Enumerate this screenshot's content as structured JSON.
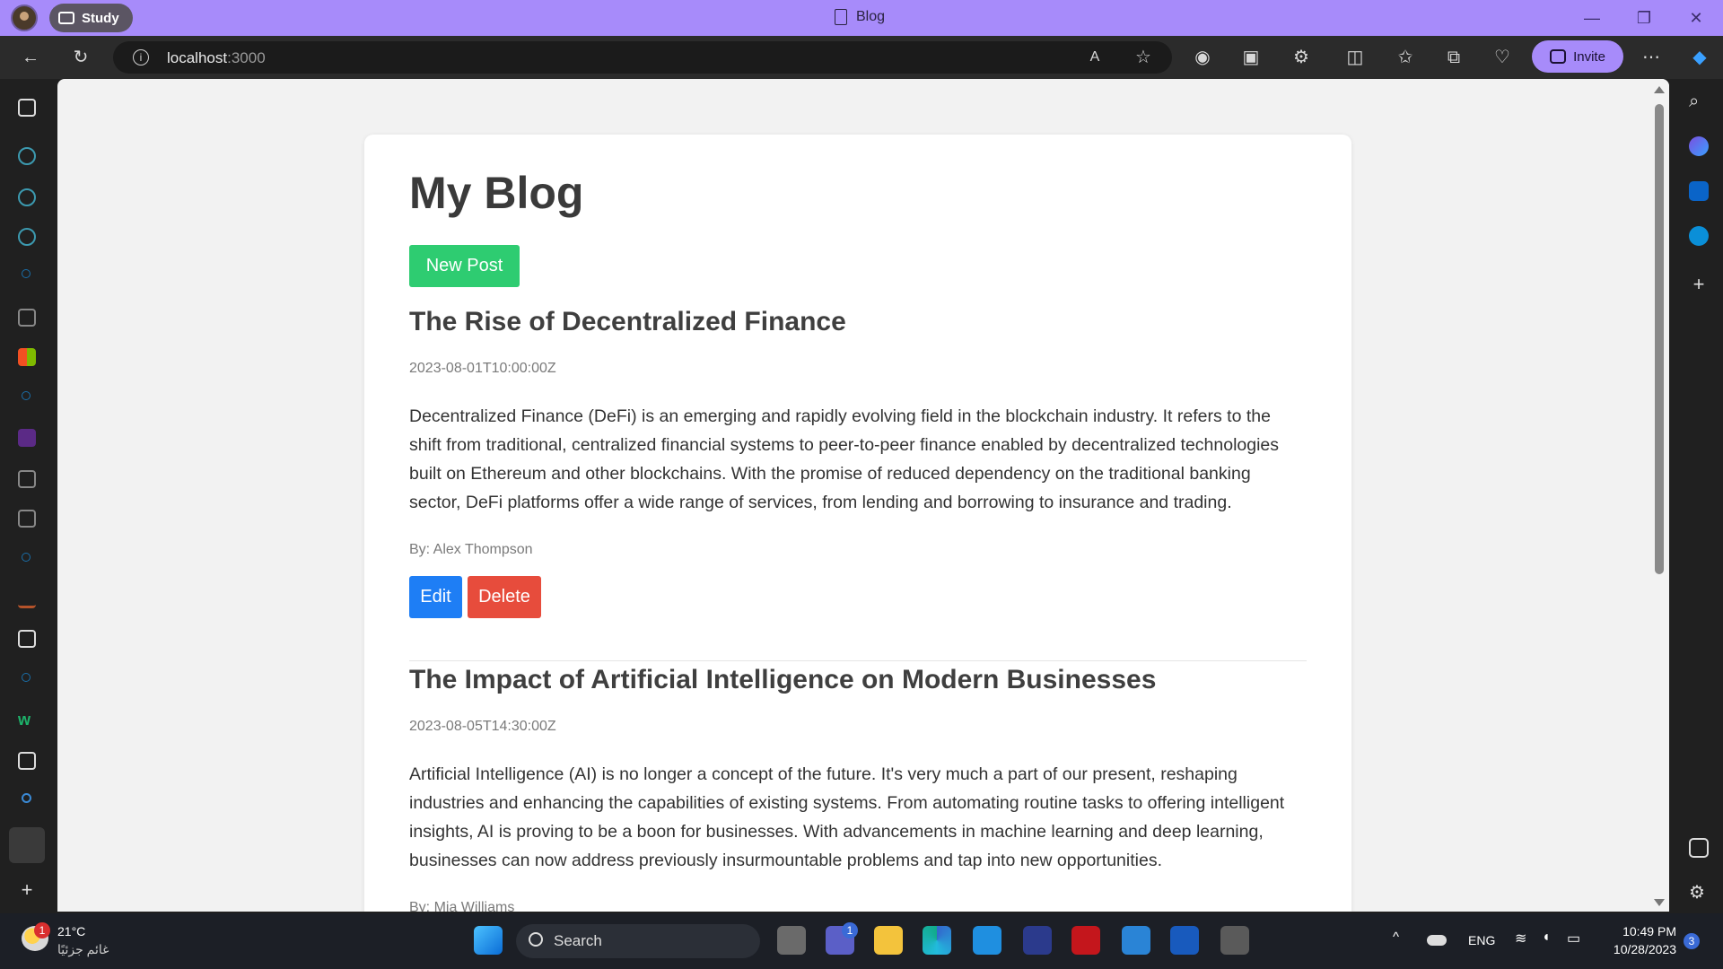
{
  "browser": {
    "workspace_label": "Study",
    "tab_title": "Blog",
    "url_host": "localhost",
    "url_port": ":3000",
    "invite_label": "Invite",
    "accent": "#a78bfa"
  },
  "page": {
    "title": "My Blog",
    "new_post_label": "New Post",
    "posts": [
      {
        "title": "The Rise of Decentralized Finance",
        "date": "2023-08-01T10:00:00Z",
        "body": "Decentralized Finance (DeFi) is an emerging and rapidly evolving field in the blockchain industry. It refers to the shift from traditional, centralized financial systems to peer-to-peer finance enabled by decentralized technologies built on Ethereum and other blockchains. With the promise of reduced dependency on the traditional banking sector, DeFi platforms offer a wide range of services, from lending and borrowing to insurance and trading.",
        "author": "By: Alex Thompson",
        "edit_label": "Edit",
        "delete_label": "Delete"
      },
      {
        "title": "The Impact of Artificial Intelligence on Modern Businesses",
        "date": "2023-08-05T14:30:00Z",
        "body": "Artificial Intelligence (AI) is no longer a concept of the future. It's very much a part of our present, reshaping industries and enhancing the capabilities of existing systems. From automating routine tasks to offering intelligent insights, AI is proving to be a boon for businesses. With advancements in machine learning and deep learning, businesses can now address previously insurmountable problems and tap into new opportunities.",
        "author": "By: Mia Williams"
      }
    ],
    "colors": {
      "new_post": "#2ecc71",
      "edit": "#1e7ef5",
      "delete": "#e74c3c"
    }
  },
  "taskbar": {
    "weather_temp": "21°C",
    "weather_desc": "غائم جزئيًا",
    "weather_badge": "1",
    "search_label": "Search",
    "teams_badge": "1",
    "lang": "ENG",
    "time": "10:49 PM",
    "date": "10/28/2023",
    "notif_count": "3"
  }
}
